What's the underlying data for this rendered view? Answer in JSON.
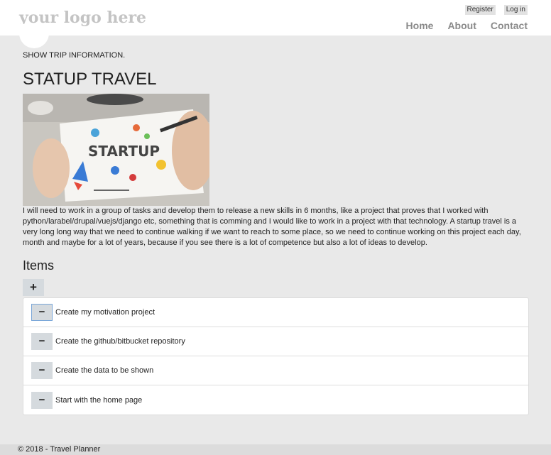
{
  "header": {
    "logo": "your logo here",
    "auth": {
      "register": "Register",
      "login": "Log in"
    },
    "nav": [
      {
        "label": "Home"
      },
      {
        "label": "About"
      },
      {
        "label": "Contact"
      }
    ]
  },
  "main": {
    "subtitle": "SHOW TRIP INFORMATION.",
    "title": "STATUP TRAVEL",
    "image_alt": "STARTUP",
    "description": "I will need to work in a group of tasks and develop them to release a new skills in 6 months, like a project that proves that I worked with python/larabel/drupal/vuejs/django etc, something that is comming and I would like to work in a project with that technology. A startup travel is a very long long way that we need to continue walking if we want to reach to some place, so we need to continue working on this project each day, month and maybe for a lot of years, because if you see there is a lot of competence but also a lot of ideas to develop.",
    "items_title": "Items",
    "add_label": "+",
    "remove_label": "−",
    "items": [
      {
        "label": "Create my motivation project"
      },
      {
        "label": "Create the github/bitbucket repository"
      },
      {
        "label": "Create the data to be shown"
      },
      {
        "label": "Start with the home page"
      }
    ]
  },
  "footer": {
    "text": "© 2018 - Travel Planner"
  }
}
